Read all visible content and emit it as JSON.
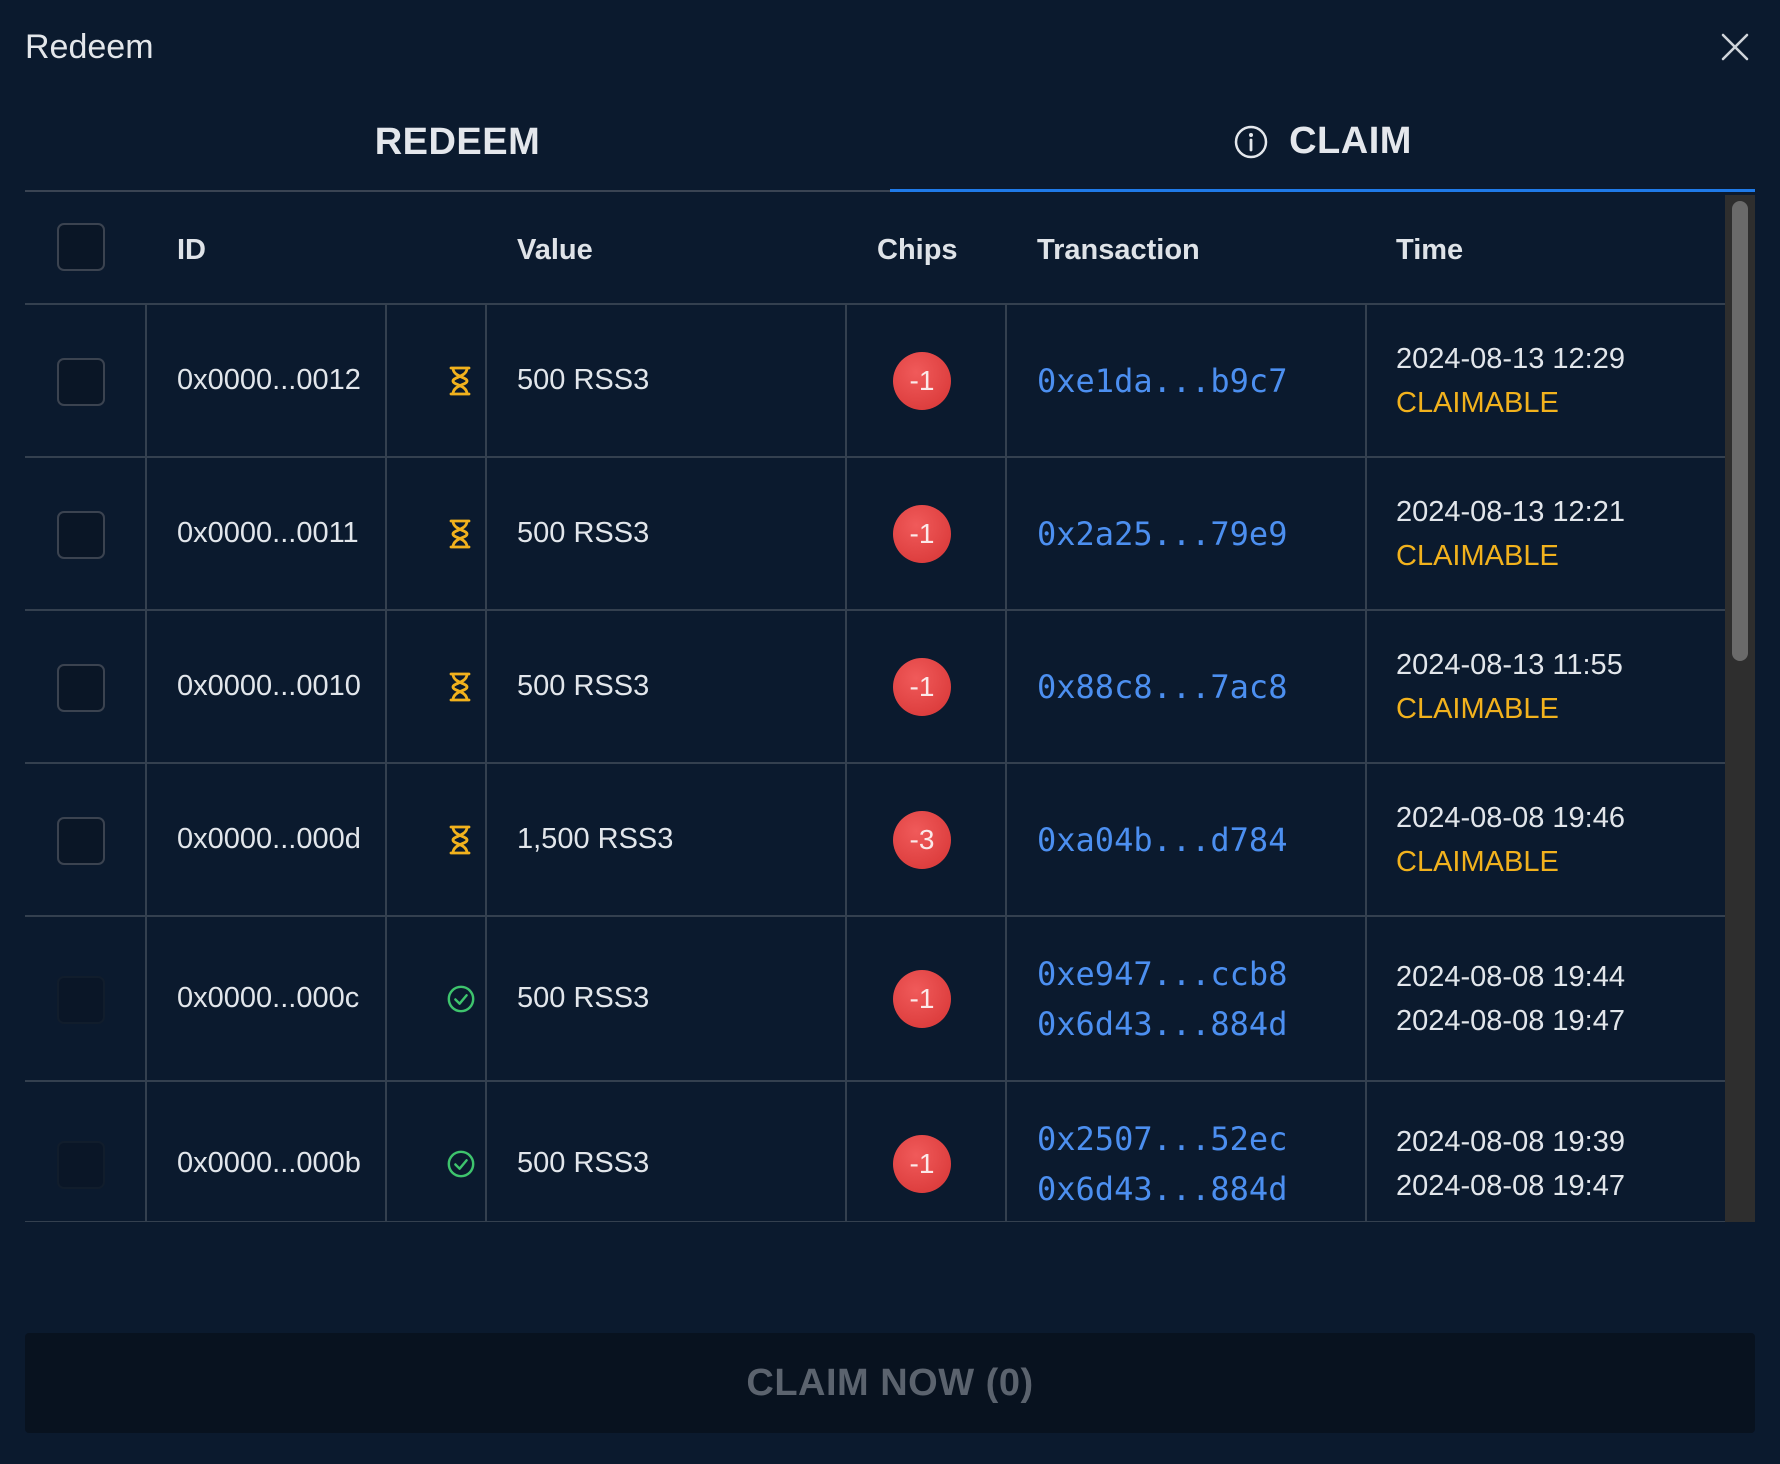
{
  "dialog": {
    "title": "Redeem"
  },
  "tabs": [
    {
      "label": "REDEEM",
      "active": false
    },
    {
      "label": "CLAIM",
      "active": true,
      "icon": "info-icon"
    }
  ],
  "table": {
    "headers": {
      "id": "ID",
      "value": "Value",
      "chips": "Chips",
      "transaction": "Transaction",
      "time": "Time"
    },
    "rows": [
      {
        "id": "0x0000...0012",
        "status": "pending",
        "value": "500 RSS3",
        "chips": "-1",
        "tx": [
          "0xe1da...b9c7"
        ],
        "times": [
          "2024-08-13 12:29"
        ],
        "claim_status": "CLAIMABLE"
      },
      {
        "id": "0x0000...0011",
        "status": "pending",
        "value": "500 RSS3",
        "chips": "-1",
        "tx": [
          "0x2a25...79e9"
        ],
        "times": [
          "2024-08-13 12:21"
        ],
        "claim_status": "CLAIMABLE"
      },
      {
        "id": "0x0000...0010",
        "status": "pending",
        "value": "500 RSS3",
        "chips": "-1",
        "tx": [
          "0x88c8...7ac8"
        ],
        "times": [
          "2024-08-13 11:55"
        ],
        "claim_status": "CLAIMABLE"
      },
      {
        "id": "0x0000...000d",
        "status": "pending",
        "value": "1,500 RSS3",
        "chips": "-3",
        "tx": [
          "0xa04b...d784"
        ],
        "times": [
          "2024-08-08 19:46"
        ],
        "claim_status": "CLAIMABLE"
      },
      {
        "id": "0x0000...000c",
        "status": "claimed",
        "value": "500 RSS3",
        "chips": "-1",
        "tx": [
          "0xe947...ccb8",
          "0x6d43...884d"
        ],
        "times": [
          "2024-08-08 19:44",
          "2024-08-08 19:47"
        ],
        "claim_status": ""
      },
      {
        "id": "0x0000...000b",
        "status": "claimed",
        "value": "500 RSS3",
        "chips": "-1",
        "tx": [
          "0x2507...52ec",
          "0x6d43...884d"
        ],
        "times": [
          "2024-08-08 19:39",
          "2024-08-08 19:47"
        ],
        "claim_status": ""
      }
    ]
  },
  "footer": {
    "claim_button": "CLAIM NOW (0)"
  },
  "colors": {
    "background": "#0b1a2e",
    "accent": "#1f7ae8",
    "link": "#4c8ff0",
    "claimable": "#f2b21d",
    "chip": "#e04545",
    "success": "#3ec46d"
  }
}
